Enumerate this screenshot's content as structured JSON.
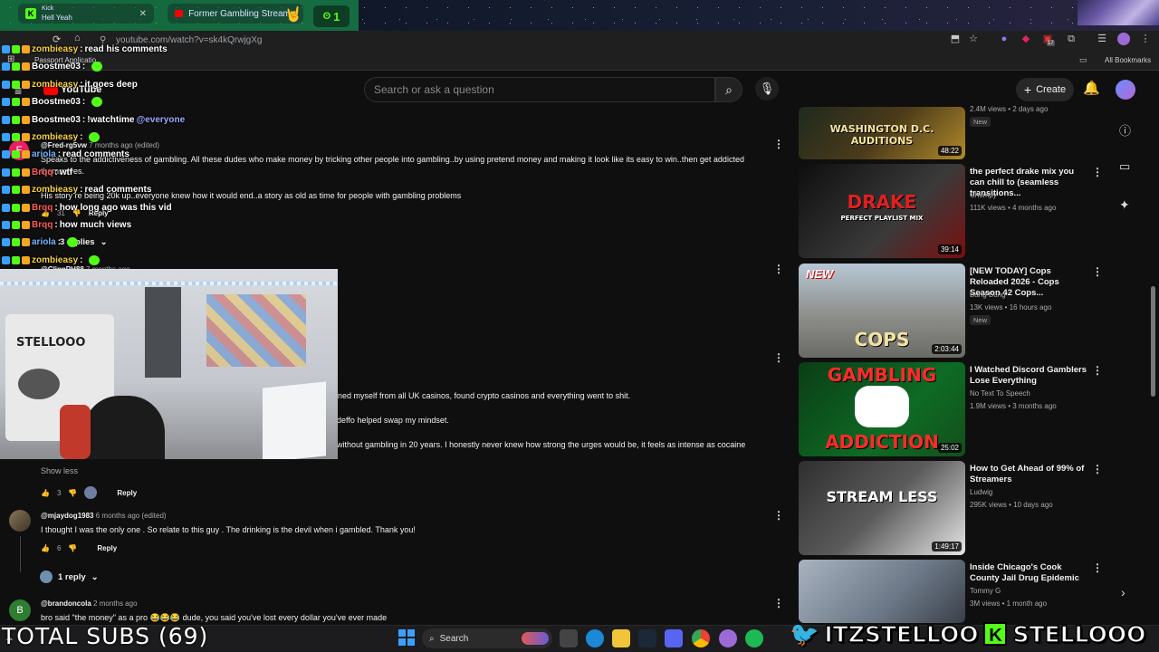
{
  "browser": {
    "tabs": [
      {
        "label": "Kick",
        "sublabel": "Hell Yeah"
      },
      {
        "label": "Former Gambling Streamer E"
      }
    ],
    "url": "youtube.com/watch?v=sk4kQrwjgXg",
    "bookmark": "Passport Applicatio...",
    "all_bookmarks": "All Bookmarks",
    "ext_badge": "17",
    "counter": "1"
  },
  "header": {
    "logo": "YouTube",
    "search_placeholder": "Search or ask a question",
    "create_label": "Create"
  },
  "comments": {
    "c1": {
      "author": "@Fred-rg5vw",
      "time": "7 months ago (edited)",
      "text1": "Speaks to the addictiveness of gambling.   All these dudes who make money by tricking other people into gambling..by using pretend money and making it look like its easy to win..then get addicted",
      "text2": "themselves.",
      "text3": "His story re being 20k up..everyone knew how it would end..a story as old as time for people with gambling problems",
      "likes": "31",
      "reply": "Reply",
      "replies": "3 replies"
    },
    "c2": {
      "author": "@ClinnPH88",
      "time": "7 months ago",
      "line1": "nned myself from all UK casinos, found crypto casinos and everything went to shit.",
      "line2": "deffo helped swap my mindset.",
      "line3": "without gambling in 20 years. I honestly never knew how strong the urges would be, it feels as intense as cocaine",
      "show_less": "Show less",
      "likes": "3",
      "reply": "Reply"
    },
    "c3": {
      "author": "@mjaydog1983",
      "time": "6 months ago (edited)",
      "text": "I thought I was the only one . So relate to this guy . The drinking is the devil when i gambled. Thank you!",
      "likes": "6",
      "reply": "Reply",
      "replies": "1 reply"
    },
    "c4": {
      "avatar_letter": "B",
      "author": "@brandoncola",
      "time": "2 months ago",
      "text": "bro said \"the money\" as a pro 😂😂😂 dude, you said you've lost every dollar you've ever made"
    }
  },
  "chat": [
    {
      "user": "zombieasy",
      "msg": "read his comments",
      "color": "#f5d142"
    },
    {
      "user": "Boostme03",
      "msg": "",
      "color": "#ffffff"
    },
    {
      "user": "zombieasy",
      "msg": "it goes deep",
      "color": "#f5d142"
    },
    {
      "user": "Boostme03",
      "msg": "",
      "color": "#ffffff"
    },
    {
      "user": "Boostme03",
      "msg": "!watchtime",
      "mention": "@everyone",
      "color": "#ffffff"
    },
    {
      "user": "zombieasy",
      "msg": "",
      "color": "#f5d142"
    },
    {
      "user": "ariola",
      "msg": "read comments",
      "color": "#6fb4ff"
    },
    {
      "user": "Brqq",
      "msg": "wtf",
      "color": "#ff5a5a"
    },
    {
      "user": "zombieasy",
      "msg": "read comments",
      "color": "#f5d142"
    },
    {
      "user": "Brqq",
      "msg": "how long ago was this vid",
      "color": "#ff5a5a"
    },
    {
      "user": "Brqq",
      "msg": "how much views",
      "color": "#ff5a5a"
    },
    {
      "user": "ariola",
      "msg": "",
      "color": "#6fb4ff"
    },
    {
      "user": "zombieasy",
      "msg": "",
      "color": "#f5d142"
    }
  ],
  "sidebar": [
    {
      "meta": "2.4M views • 2 days ago",
      "badge": "New",
      "duration": "48:22",
      "thumb_text": "WASHINGTON D.C. AUDITIONS"
    },
    {
      "title": "the perfect drake mix you can chill to (seamless transitions...",
      "channel": "Chumpy",
      "meta": "111K views • 4 months ago",
      "duration": "39:14",
      "thumb_text": "DRAKE",
      "thumb_sub": "PERFECT PLAYLIST MIX"
    },
    {
      "title": "[NEW TODAY] Cops Reloaded 2026 - Cops Season 42 Cops...",
      "channel": "Bang Bung",
      "meta": "13K views • 16 hours ago",
      "badge": "New",
      "duration": "2:03:44",
      "thumb_text": "COPS",
      "thumb_new": "NEW"
    },
    {
      "title": "I Watched Discord Gamblers Lose Everything",
      "channel": "No Text To Speech",
      "meta": "1.9M views • 3 months ago",
      "duration": "25:02",
      "thumb_text": "GAMBLING",
      "thumb_sub": "ADDICTION"
    },
    {
      "title": "How to Get Ahead of 99% of Streamers",
      "channel": "Ludwig",
      "meta": "295K views • 10 days ago",
      "duration": "1:49:17",
      "thumb_text": "STREAM LESS"
    },
    {
      "title": "Inside Chicago's Cook County Jail Drug Epidemic",
      "channel": "Tommy G",
      "meta": "3M views • 1 month ago"
    }
  ],
  "overlay": {
    "total_subs": "TOTAL SUBS (69)",
    "twitter_handle": "ITZSTELLOO",
    "kick_handle": "STELLOOO"
  },
  "taskbar": {
    "search": "Search"
  }
}
